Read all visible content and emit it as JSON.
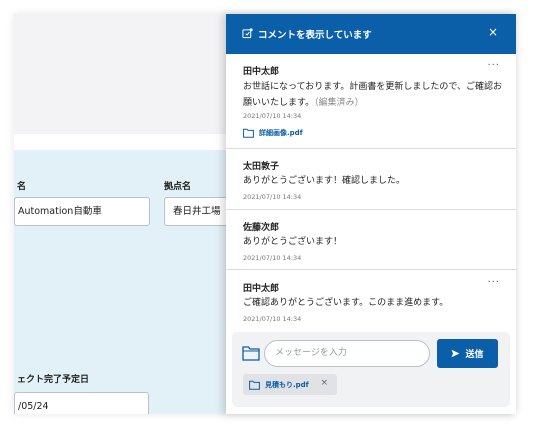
{
  "form": {
    "name_label": "名",
    "name_value": "Automation自動車",
    "base_label": "拠点名",
    "base_value": "春日井工場",
    "date_label": "ェクト完了予定日",
    "date_value": "/05/24"
  },
  "panel": {
    "title": "コメントを表示しています",
    "close_icon": "close-icon",
    "accent_color": "#0b5ea8"
  },
  "comments": [
    {
      "author": "田中太郎",
      "body": "お世話になっております。計画書を更新しましたので、ご確認お願いいたします。",
      "edited": "（編集済み）",
      "time": "2021/07/10 14:34",
      "attachment": "詳細画像.pdf",
      "more": "···"
    },
    {
      "author": "太田敦子",
      "body": "ありがとうございます！確認しました。",
      "time": "2021/07/10 14:34"
    },
    {
      "author": "佐藤次郎",
      "body": "ありがとうございます！",
      "time": "2021/07/10 14:34"
    },
    {
      "author": "田中太郎",
      "body": "ご確認ありがとうございます。このまま進めます。",
      "time": "2021/07/10 14:34",
      "more": "···"
    }
  ],
  "composer": {
    "placeholder": "メッセージを入力",
    "send_label": "送信",
    "attachment": "見積もり.pdf",
    "remove_icon": "×"
  }
}
